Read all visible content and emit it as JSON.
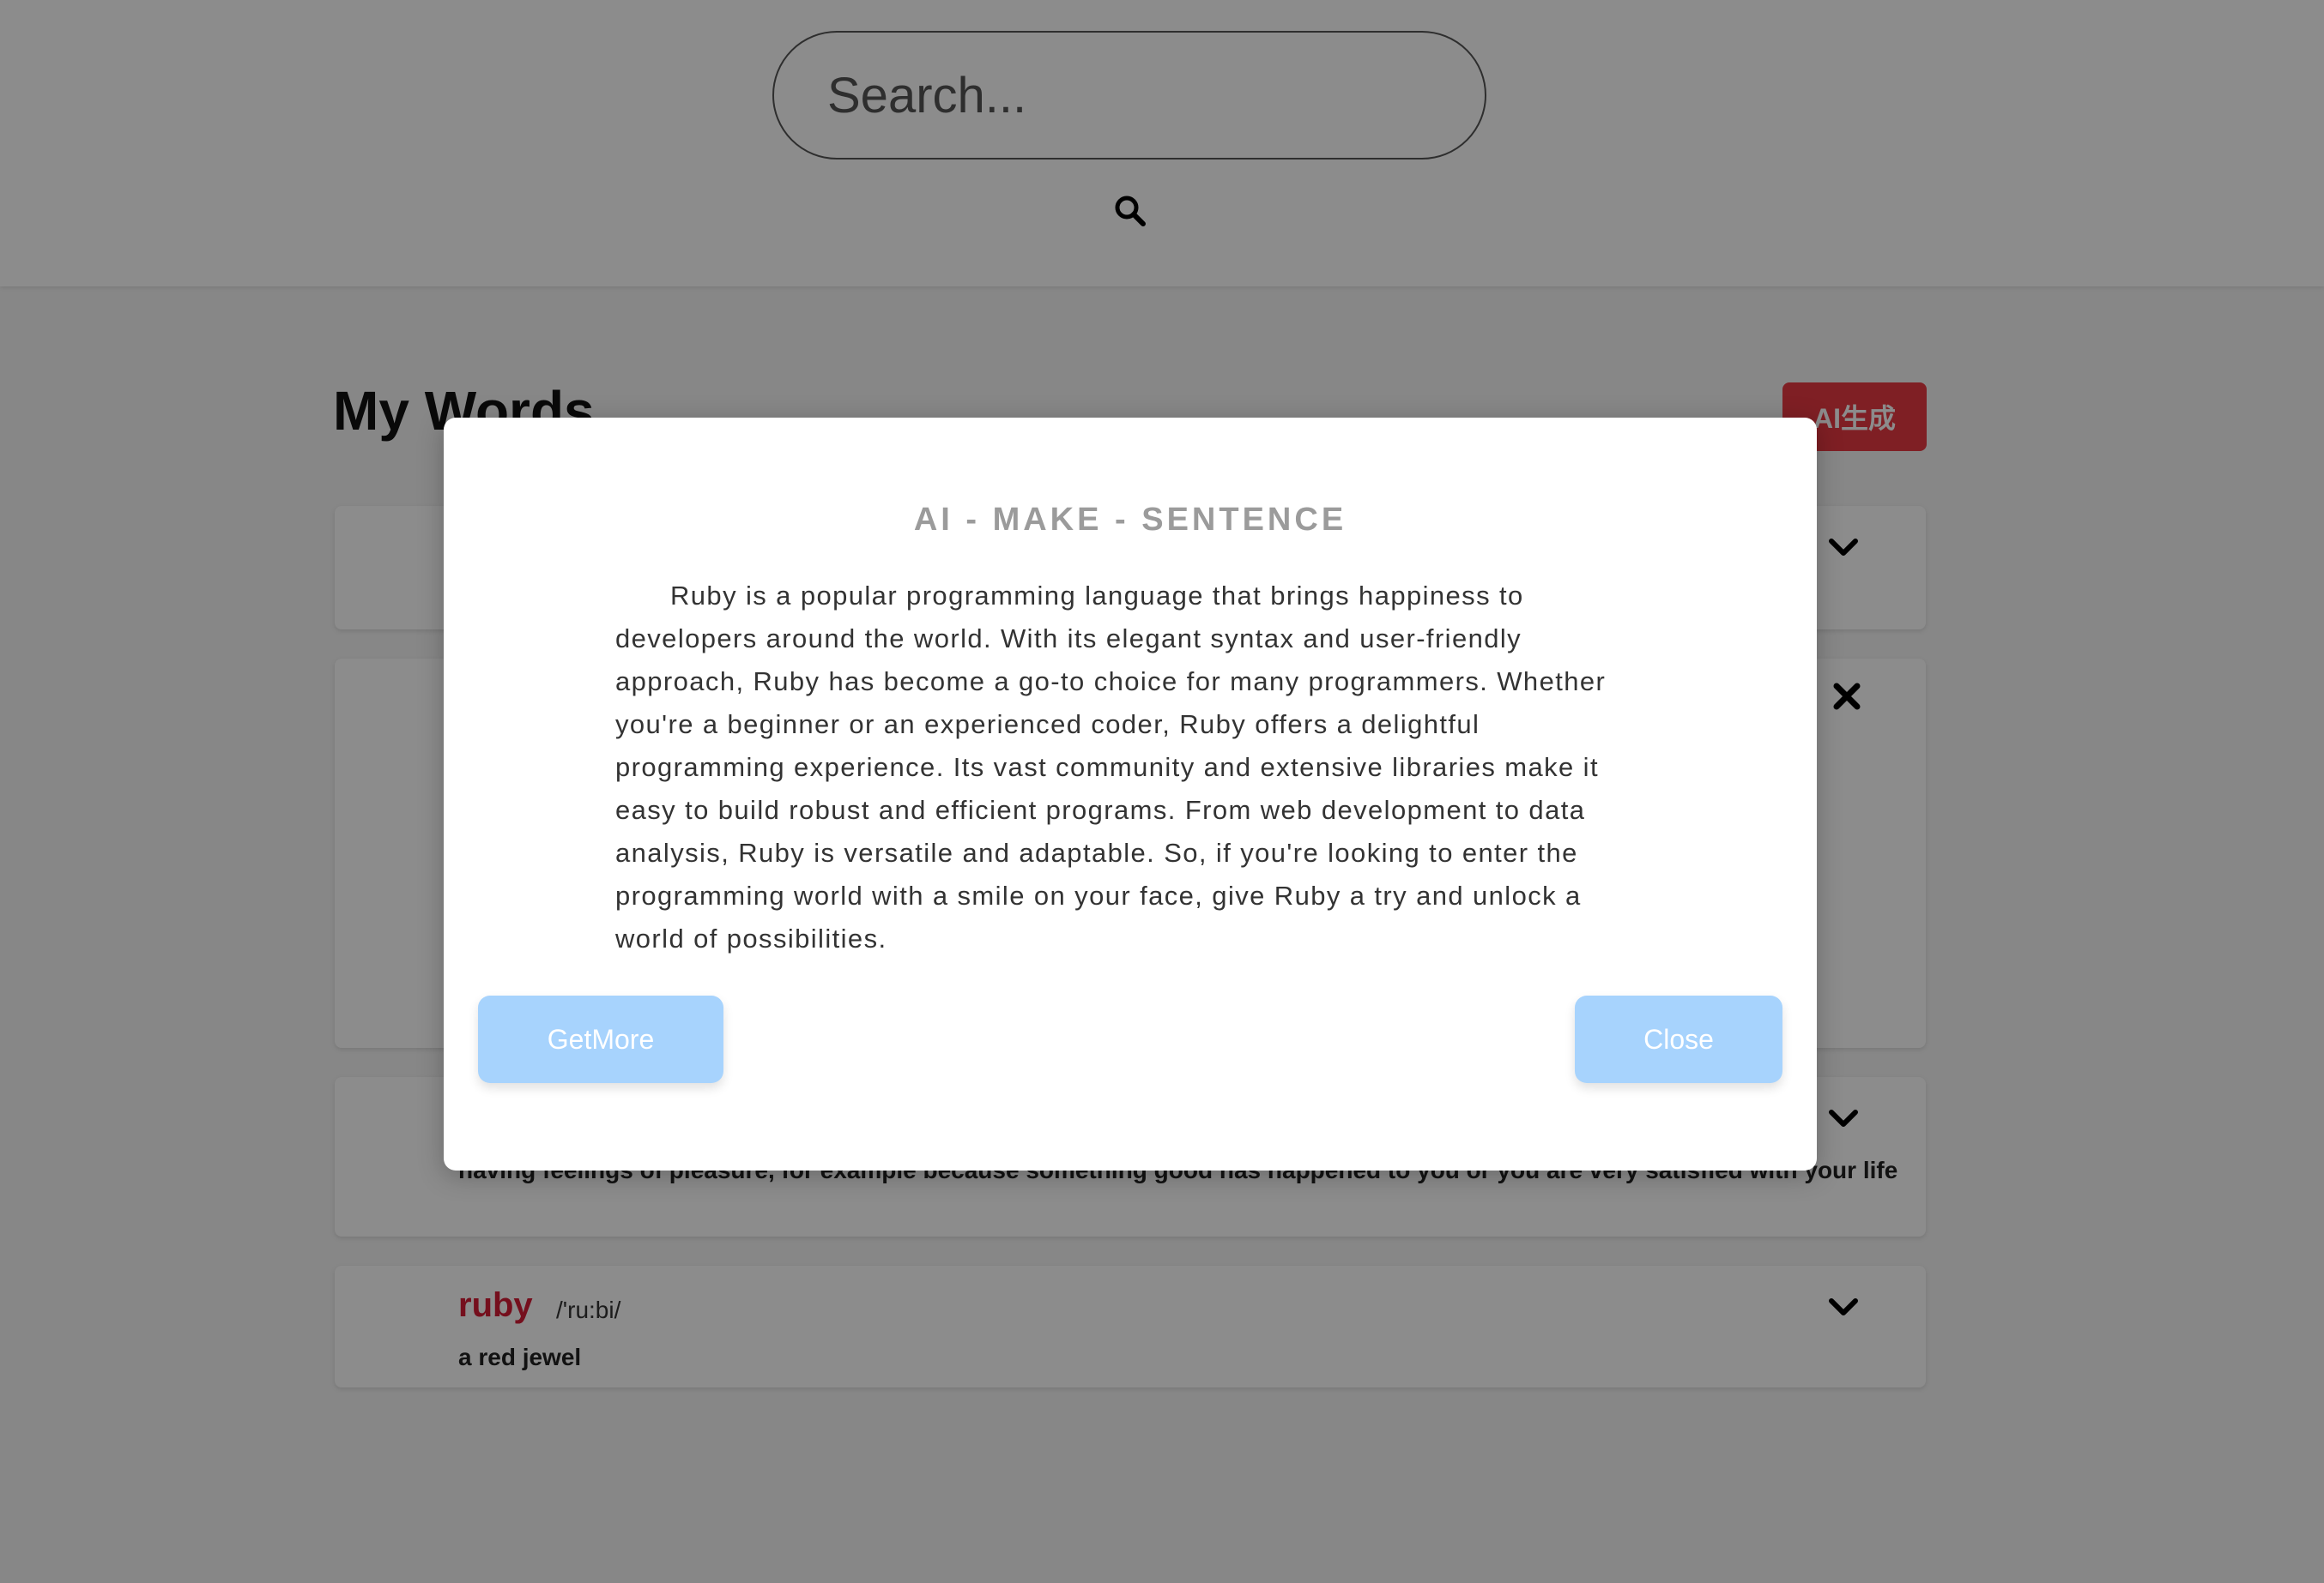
{
  "search": {
    "placeholder": "Search...",
    "icon": "search-icon"
  },
  "main": {
    "title": "My Words",
    "ai_button_label": "AI生成",
    "cards": [
      {
        "icon": "chevron-down-icon"
      },
      {
        "icon": "close-icon"
      },
      {
        "icon": "chevron-down-icon",
        "definition": "having feelings of pleasure, for example because something good has happened to you or you are very satisfied with your life"
      },
      {
        "icon": "chevron-down-icon",
        "word": "ruby",
        "phonetic": "/'ru:bi/",
        "definition": "a red jewel"
      }
    ]
  },
  "modal": {
    "title": "AI - MAKE - SENTENCE",
    "body": "Ruby is a popular programming language that brings happiness to developers around the world. With its elegant syntax and user-friendly approach, Ruby has become a go-to choice for many programmers. Whether you're a beginner or an experienced coder, Ruby offers a delightful programming experience. Its vast community and extensive libraries make it easy to build robust and efficient programs. From web development to data analysis, Ruby is versatile and adaptable. So, if you're looking to enter the programming world with a smile on your face, give Ruby a try and unlock a world of possibilities.",
    "getmore_label": "GetMore",
    "close_label": "Close"
  },
  "colors": {
    "accent_red": "#d51c35",
    "ai_button": "#e83a43",
    "modal_button": "#a7d3fd"
  }
}
